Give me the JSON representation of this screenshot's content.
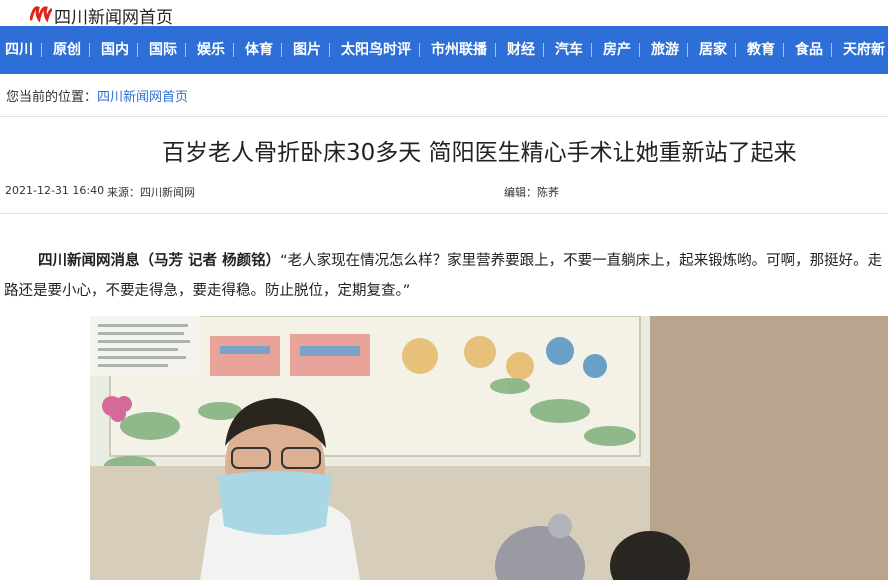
{
  "site": {
    "title": "四川新闻网首页"
  },
  "nav": {
    "items": [
      "四川",
      "原创",
      "国内",
      "国际",
      "娱乐",
      "体育",
      "图片",
      "太阳鸟时评",
      "市州联播",
      "财经",
      "汽车",
      "房产",
      "旅游",
      "居家",
      "教育",
      "食品",
      "天府新"
    ]
  },
  "breadcrumb": {
    "prefix": "您当前的位置：",
    "link": "四川新闻网首页"
  },
  "article": {
    "title": "百岁老人骨折卧床30多天 简阳医生精心手术让她重新站了起来",
    "datetime": "2021-12-31 16:40",
    "source": "来源：四川新闻网",
    "editor": "编辑：陈荞",
    "lead_bold": "四川新闻网消息（马芳 记者 杨颜铭）",
    "lead_text": "“老人家现在情况怎么样？家里营养要跟上，不要一直躺床上，起来锻炼哟。可啊，那挺好。走路还是要小心，不要走得急，要走得稳。防止脱位，定期复查。”"
  },
  "colors": {
    "nav_bg": "#2d6fd6",
    "link": "#2d6fd6",
    "logo_red": "#e0251b"
  }
}
